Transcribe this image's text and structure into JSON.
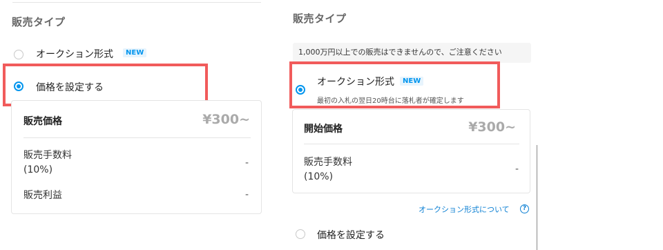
{
  "left": {
    "section_title": "販売タイプ",
    "auction_label": "オークション形式",
    "new_badge": "NEW",
    "fixed_label": "価格を設定する",
    "price_label": "販売価格",
    "price_value": "¥300~",
    "fee_label_line1": "販売手数料",
    "fee_label_line2": "(10%)",
    "fee_value": "-",
    "profit_label": "販売利益",
    "profit_value": "-",
    "selected": "fixed"
  },
  "right": {
    "section_title": "販売タイプ",
    "notice": "1,000万円以上での販売はできませんので、ご注意ください",
    "auction_label": "オークション形式",
    "new_badge": "NEW",
    "auction_sub": "最初の入札の翌日20時台に落札者が確定します",
    "start_price_label": "開始価格",
    "start_price_value": "¥300~",
    "fee_label_line1": "販売手数料",
    "fee_label_line2": "(10%)",
    "fee_value": "-",
    "about_link": "オークション形式について",
    "help_glyph": "?",
    "fixed_label": "価格を設定する",
    "selected": "auction"
  },
  "colors": {
    "accent": "#0095ee",
    "highlight": "#f15b5b",
    "link": "#0b7fd3"
  }
}
